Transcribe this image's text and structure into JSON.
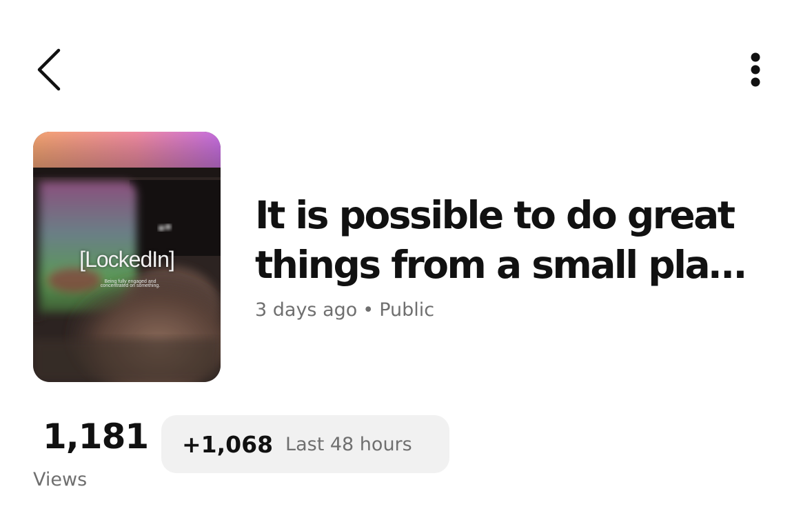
{
  "header": {
    "back_icon": "chevron-left-icon",
    "more_icon": "vertical-ellipsis-icon"
  },
  "post": {
    "thumbnail": {
      "brand": "[LockedIn]",
      "caption": "Being fully engaged and concentrated on something."
    },
    "title": "It is possible to do great things from a small pla…",
    "meta": {
      "time": "3 days ago",
      "separator": "•",
      "visibility": "Public"
    }
  },
  "stats": {
    "views_count": "1,181",
    "views_label": "Views",
    "delta": "+1,068",
    "delta_period": "Last 48 hours"
  },
  "colors": {
    "text_primary": "#111111",
    "text_secondary": "#6f6f6f",
    "pill_background": "#f1f1f1"
  }
}
